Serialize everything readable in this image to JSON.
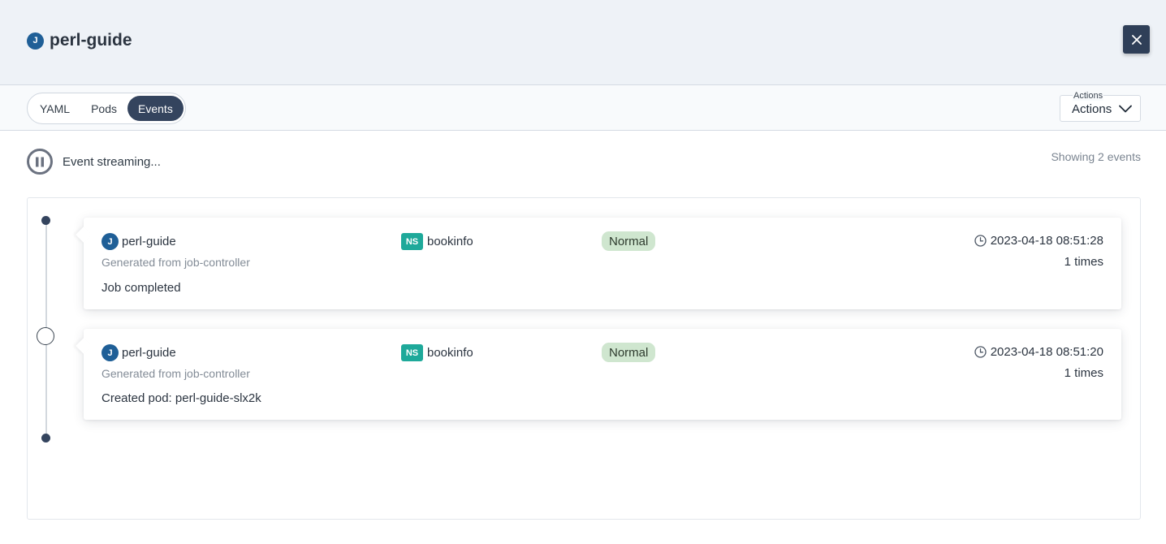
{
  "header": {
    "kind_badge": "J",
    "title": "perl-guide"
  },
  "tabs": [
    {
      "label": "YAML",
      "active": false
    },
    {
      "label": "Pods",
      "active": false
    },
    {
      "label": "Events",
      "active": true
    }
  ],
  "actions": {
    "caption": "Actions",
    "label": "Actions"
  },
  "stream": {
    "status_text": "Event streaming...",
    "count_text": "Showing 2 events"
  },
  "events": [
    {
      "kind_badge": "J",
      "name": "perl-guide",
      "source": "Generated from job-controller",
      "message": "Job completed",
      "ns_badge": "NS",
      "namespace": "bookinfo",
      "type": "Normal",
      "time": "2023-04-18 08:51:28",
      "count": "1 times"
    },
    {
      "kind_badge": "J",
      "name": "perl-guide",
      "source": "Generated from job-controller",
      "message": "Created pod: perl-guide-slx2k",
      "ns_badge": "NS",
      "namespace": "bookinfo",
      "type": "Normal",
      "time": "2023-04-18 08:51:20",
      "count": "1 times"
    }
  ],
  "icons": {
    "close": "close-icon",
    "chevron": "chevron-down-icon",
    "pause": "pause-icon",
    "clock": "clock-icon"
  },
  "colors": {
    "accent_dark": "#34445e",
    "namespace_badge": "#1ea99a",
    "normal_badge": "#cfe6cf",
    "kind_badge": "#1f5f97"
  }
}
